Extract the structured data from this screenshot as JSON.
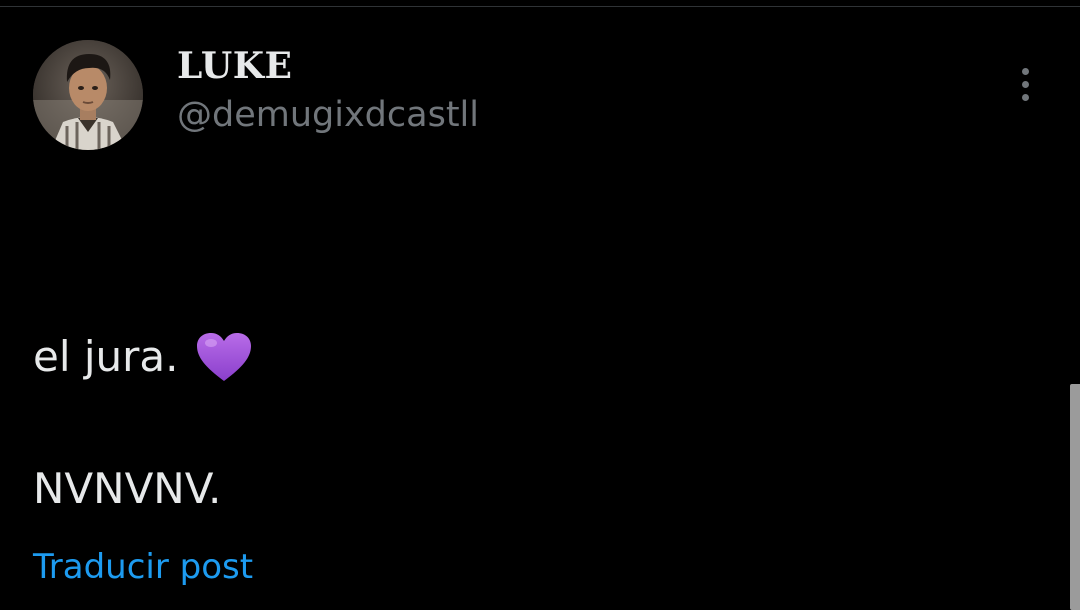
{
  "author": {
    "display_name": "LUKE",
    "handle": "@demugixdcastll",
    "avatar_icon": "profile-photo"
  },
  "post": {
    "line_1_text": "el jura.",
    "line_1_emoji": "purple-heart-icon",
    "line_2_text": "NVNVNV."
  },
  "actions": {
    "translate_label": "Traducir post",
    "more_icon": "more-vertical-icon"
  },
  "colors": {
    "background": "#000000",
    "primary_text": "#e7e9ea",
    "secondary_text": "#71767b",
    "link": "#1d9bf0",
    "heart": "#9b4dd6"
  }
}
